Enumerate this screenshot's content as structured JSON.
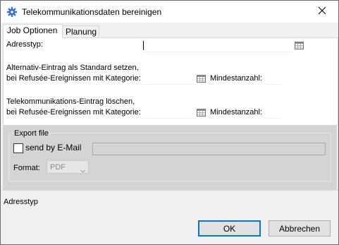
{
  "window": {
    "title": "Telekommunikationsdaten bereinigen",
    "title_icon": "gear-icon",
    "close_icon": "close-icon"
  },
  "tabs": [
    {
      "label": "Job Optionen",
      "active": true
    },
    {
      "label": "Planung",
      "active": false
    }
  ],
  "job_options": {
    "adresstyp_label": "Adresstyp:",
    "adresstyp_value": "",
    "alternativ_line1": "Alternativ-Eintrag als Standard setzen,",
    "alternativ_line2": "bei Refusée-Ereignissen mit Kategorie:",
    "alternativ_kategorie_value": "",
    "alternativ_mindestanzahl_label": "Mindestanzahl:",
    "alternativ_mindestanzahl_value": "",
    "loeschen_line1": "Telekommunikations-Eintrag löschen,",
    "loeschen_line2": "bei Refusée-Ereignissen mit Kategorie:",
    "loeschen_kategorie_value": "",
    "loeschen_mindestanzahl_label": "Mindestanzahl:",
    "loeschen_mindestanzahl_value": "",
    "list_icon": "table-icon"
  },
  "export": {
    "group_label": "Export file",
    "send_email_label": "send by E-Mail",
    "send_email_checked": false,
    "email_value": "",
    "format_label": "Format:",
    "format_selected": "PDF"
  },
  "status_text": "Adresstyp",
  "buttons": {
    "ok_label": "OK",
    "cancel_label": "Abbrechen"
  },
  "colors": {
    "title_icon": "#3a6fd8",
    "default_button_border": "#0078d7",
    "export_background": "#d4d4d4"
  }
}
